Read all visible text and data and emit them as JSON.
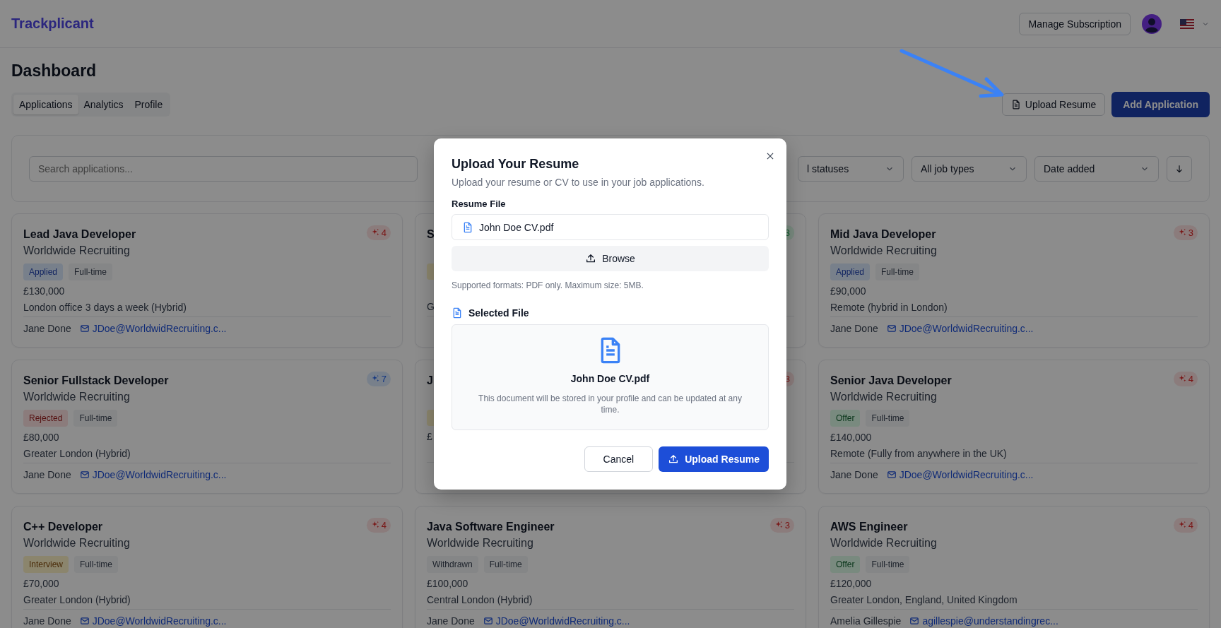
{
  "header": {
    "logo": "Trackplicant",
    "manage_button": "Manage Subscription"
  },
  "page_title": "Dashboard",
  "tabs": [
    {
      "label": "Applications",
      "selected": true
    },
    {
      "label": "Analytics",
      "selected": false
    },
    {
      "label": "Profile",
      "selected": false
    }
  ],
  "upload_button": "Upload Resume",
  "add_button": "Add Application",
  "filters": {
    "search": {
      "placeholder": "Search applications..."
    },
    "selects": [
      "l statuses",
      "All job types",
      "Date added"
    ]
  },
  "cards": [
    {
      "title": "Lead Java Developer",
      "company": "Worldwide Recruiting",
      "status": {
        "label": "Applied",
        "kind": "applied"
      },
      "job_type": "Full-time",
      "salary": "£130,000",
      "location": "London office 3 days a week (Hybrid)",
      "contact": "Jane Done",
      "email": "JDoe@WorldwidRecruiting.c...",
      "score": {
        "value": "4",
        "kind": "red"
      }
    },
    {
      "title": "S",
      "status": {
        "kind": "interview"
      },
      "location": "G",
      "score": {
        "value": "3",
        "kind": "green",
        "icon_covered": true
      }
    },
    {
      "title": "Mid Java Developer",
      "company": "Worldwide Recruiting",
      "status": {
        "label": "Applied",
        "kind": "applied"
      },
      "job_type": "Full-time",
      "salary": "£90,000",
      "location": "Remote (hybrid in London)",
      "contact": "Jane Done",
      "email": "JDoe@WorldwidRecruiting.c...",
      "score": {
        "value": "3",
        "kind": "red"
      }
    },
    {
      "title": "Senior Fullstack Developer",
      "company": "Worldwide Recruiting",
      "status": {
        "label": "Rejected",
        "kind": "rejected"
      },
      "job_type": "Full-time",
      "salary": "£80,000",
      "location": "Greater London (Hybrid)",
      "contact": "Jane Done",
      "email": "JDoe@WorldwidRecruiting.c...",
      "score": {
        "value": "7",
        "kind": "blue"
      }
    },
    {
      "title": "J",
      "status": {
        "kind": "interview"
      },
      "salary": "£",
      "score": {
        "value": "3",
        "kind": "red",
        "icon_covered": true
      }
    },
    {
      "title": "Senior Java Developer",
      "company": "Worldwide Recruiting",
      "status": {
        "label": "Offer",
        "kind": "offer"
      },
      "job_type": "Full-time",
      "salary": "£140,000",
      "location": "Remote (Fully from anywhere in the UK)",
      "contact": "Jane Done",
      "email": "JDoe@WorldwidRecruiting.c...",
      "score": {
        "value": "4",
        "kind": "red"
      }
    },
    {
      "title": "C++ Developer",
      "company": "Worldwide Recruiting",
      "status": {
        "label": "Interview",
        "kind": "interview"
      },
      "job_type": "Full-time",
      "salary": "£70,000",
      "location": "Greater London (Hybrid)",
      "contact": "Jane Done",
      "email": "JDoe@WorldwidRecruiting.c...",
      "score": {
        "value": "4",
        "kind": "red"
      }
    },
    {
      "title": "Java Software Engineer",
      "company": "Worldwide Recruiting",
      "status": {
        "label": "Withdrawn",
        "kind": "withdrawn"
      },
      "job_type": "Full-time",
      "salary": "£100,000",
      "location": "Central London (Hybrid)",
      "contact": "Jane Done",
      "email": "JDoe@WorldwidRecruiting.c...",
      "score": {
        "value": "3",
        "kind": "red"
      }
    },
    {
      "title": "AWS Engineer",
      "company": "Worldwide Recruiting",
      "status": {
        "label": "Offer",
        "kind": "offer"
      },
      "job_type": "Full-time",
      "salary": "£120,000",
      "location": "Greater London, England, United Kingdom",
      "contact": "Amelia Gillespie",
      "email": "agillespie@understandingrec...",
      "score": {
        "value": "4",
        "kind": "red"
      }
    }
  ],
  "modal": {
    "title": "Upload Your Resume",
    "description": "Upload your resume or CV to use in your job applications.",
    "file_label": "Resume File",
    "file_value": "John Doe CV.pdf",
    "browse_button": "Browse",
    "hint": "Supported formats: PDF only. Maximum size: 5MB.",
    "selected_label": "Selected File",
    "selected_name": "John Doe CV.pdf",
    "selected_note": "This document will be stored in your profile and can be updated at any time.",
    "cancel_button": "Cancel",
    "submit_button": "Upload Resume"
  }
}
